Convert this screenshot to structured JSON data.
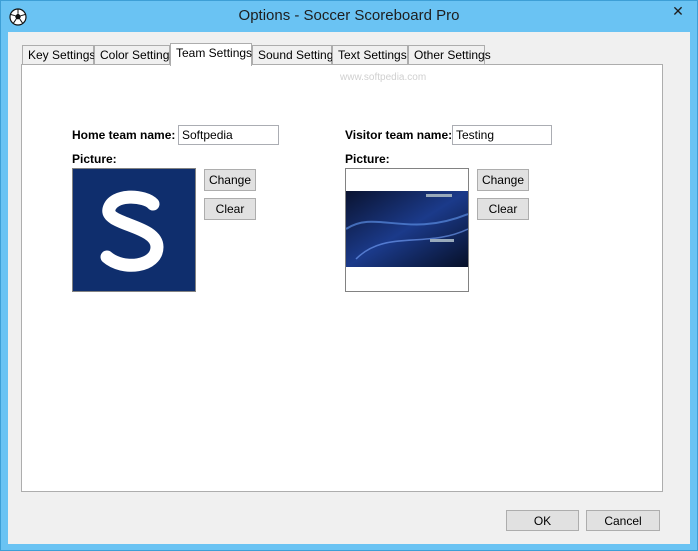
{
  "window": {
    "title": "Options - Soccer Scoreboard Pro",
    "close_glyph": "✕"
  },
  "tabs": [
    {
      "label": "Key Settings"
    },
    {
      "label": "Color Settings"
    },
    {
      "label": "Team Settings",
      "active": true
    },
    {
      "label": "Sound Settings"
    },
    {
      "label": "Text Settings"
    },
    {
      "label": "Other Settings"
    }
  ],
  "watermark": "www.softpedia.com",
  "home": {
    "name_label": "Home team name:",
    "name_value": "Softpedia",
    "picture_label": "Picture:",
    "change_label": "Change",
    "clear_label": "Clear",
    "logo_letter": "S"
  },
  "visitor": {
    "name_label": "Visitor team name:",
    "name_value": "Testing",
    "picture_label": "Picture:",
    "change_label": "Change",
    "clear_label": "Clear"
  },
  "footer": {
    "ok_label": "OK",
    "cancel_label": "Cancel"
  },
  "colors": {
    "titlebar": "#6ac3f3",
    "panel": "#ffffff",
    "dialog": "#f0f0f0",
    "logo_bg": "#0f2e6d"
  }
}
